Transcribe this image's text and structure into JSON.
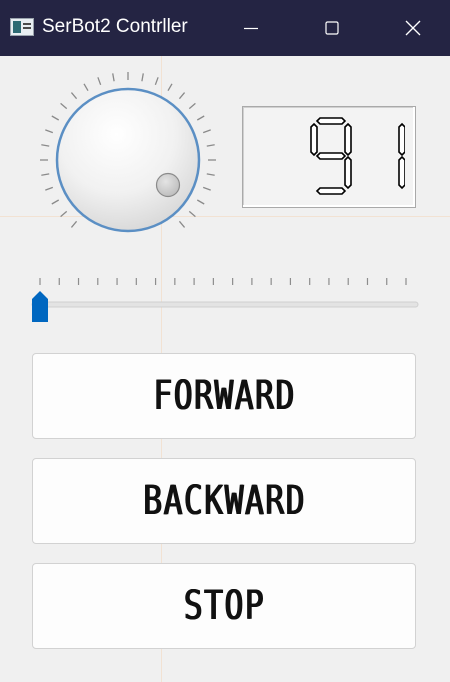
{
  "window": {
    "title": "SerBot2 Contrller",
    "controls": {
      "minimize": "minimize-icon",
      "maximize": "maximize-icon",
      "close": "close-icon"
    }
  },
  "dial": {
    "value": 91,
    "min": 0,
    "max": 180
  },
  "display": {
    "value": "91"
  },
  "slider": {
    "value": 0,
    "min": 0,
    "max": 180
  },
  "buttons": {
    "forward": "FORWARD",
    "backward": "BACKWARD",
    "stop": "STOP"
  },
  "colors": {
    "titlebar": "#242443",
    "accent": "#0067c0",
    "dial_ring": "#5b8fc4"
  }
}
